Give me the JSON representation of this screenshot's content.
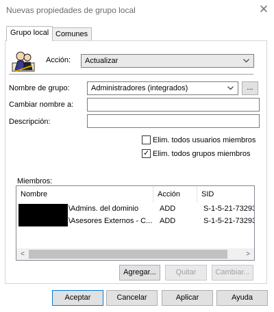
{
  "window": {
    "title": "Nuevas propiedades de grupo local"
  },
  "tabs": [
    {
      "label": "Grupo local",
      "active": true
    },
    {
      "label": "Comunes",
      "active": false
    }
  ],
  "form": {
    "accion_label": "Acción:",
    "accion_value": "Actualizar",
    "group_name_label": "Nombre de grupo:",
    "group_name_value": "Administradores (integrados)",
    "browse_label": "...",
    "rename_label": "Cambiar nombre a:",
    "rename_value": "",
    "description_label": "Descripción:",
    "description_value": ""
  },
  "options": [
    {
      "label": "Elim. todos usuarios miembros",
      "checked": false
    },
    {
      "label": "Elim. todos grupos miembros",
      "checked": true
    }
  ],
  "members": {
    "label": "Miembros:",
    "columns": [
      "Nombre",
      "Acción",
      "SID"
    ],
    "rows": [
      {
        "name": "\\Admins. del dominio",
        "action": "ADD",
        "sid": "S-1-5-21-73293"
      },
      {
        "name": "\\Asesores Externos - C...",
        "action": "ADD",
        "sid": "S-1-5-21-73293"
      }
    ]
  },
  "list_buttons": {
    "add": "Agregar...",
    "remove": "Quitar",
    "change": "Cambiar..."
  },
  "footer_buttons": {
    "ok": "Aceptar",
    "cancel": "Cancelar",
    "apply": "Aplicar",
    "help": "Ayuda"
  },
  "colors": {
    "accent": "#0078d7",
    "panel_border": "#d4d4d4",
    "disabled_text": "#a0a0a0"
  },
  "icons": [
    "close-icon",
    "group-users-icon",
    "chevron-down-icon",
    "checkbox-check-icon",
    "scroll-left-icon",
    "scroll-right-icon"
  ]
}
